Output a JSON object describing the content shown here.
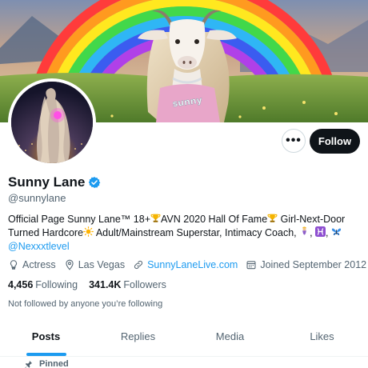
{
  "profile": {
    "display_name": "Sunny Lane",
    "handle": "@sunnylane",
    "verified": true
  },
  "banner": {
    "goat_necklace_text": "sunny"
  },
  "actions": {
    "more_label": "•••",
    "follow_label": "Follow"
  },
  "bio": {
    "line1_a": "Official Page Sunny Lane™ 18+",
    "line1_b": "AVN 2020 Hall Of Fame",
    "line1_c": " Girl-Next-Door",
    "line2_a": "Turned Hardcore",
    "line2_b": " Adult/Mainstream Superstar, Intimacy Coach, ",
    "line2_c": ", ",
    "line2_d": ", ",
    "mention": "@Nexxxtlevel",
    "emojis": [
      "trophy",
      "trophy",
      "sun",
      "genie",
      "pisces",
      "butterfly"
    ]
  },
  "meta": {
    "profession": "Actress",
    "location": "Las Vegas",
    "website": "SunnyLaneLive.com",
    "joined": "Joined September 2012"
  },
  "counts": {
    "following_num": "4,456",
    "following_label": "Following",
    "followers_num": "341.4K",
    "followers_label": "Followers"
  },
  "not_followed_text": "Not followed by anyone you’re following",
  "tabs": [
    {
      "label": "Posts",
      "active": true
    },
    {
      "label": "Replies",
      "active": false
    },
    {
      "label": "Media",
      "active": false
    },
    {
      "label": "Likes",
      "active": false
    }
  ],
  "pinned_label": "Pinned",
  "colors": {
    "accent": "#1d9bf0",
    "text": "#0f1419",
    "muted": "#536471",
    "button_dark": "#0f1419"
  }
}
